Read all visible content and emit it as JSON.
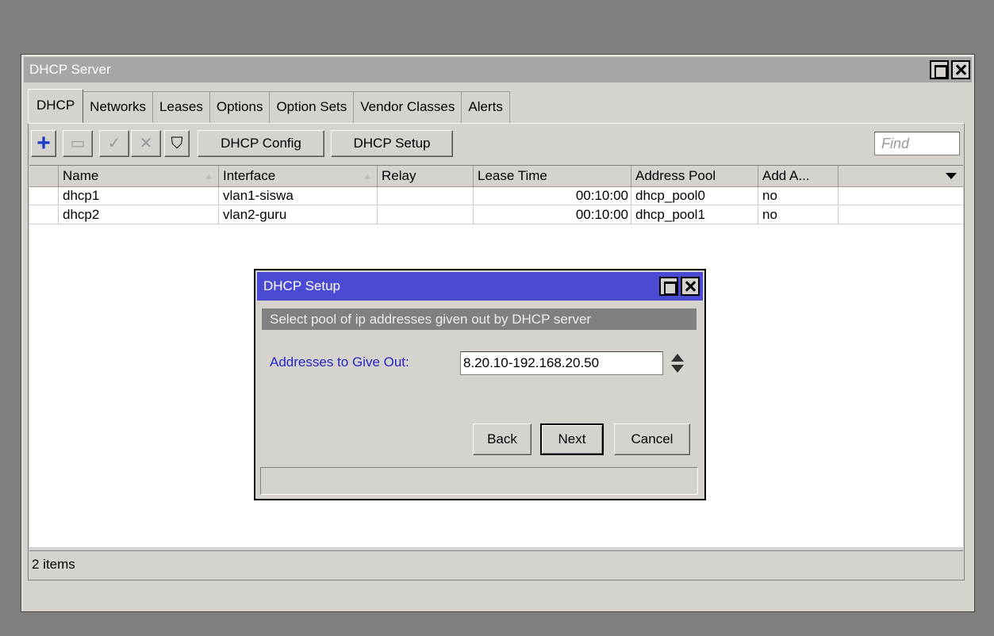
{
  "window": {
    "title": "DHCP Server",
    "tabs": [
      {
        "label": "DHCP",
        "active": true
      },
      {
        "label": "Networks"
      },
      {
        "label": "Leases"
      },
      {
        "label": "Options"
      },
      {
        "label": "Option Sets"
      },
      {
        "label": "Vendor Classes"
      },
      {
        "label": "Alerts"
      }
    ]
  },
  "toolbar": {
    "add_icon": "plus-icon",
    "remove_icon": "minus-icon",
    "enable_icon": "check-icon",
    "disable_icon": "cross-icon",
    "filter_icon": "filter-icon",
    "dhcp_config_label": "DHCP Config",
    "dhcp_setup_label": "DHCP Setup",
    "find_placeholder": "Find"
  },
  "table": {
    "columns": [
      "Name",
      "Interface",
      "Relay",
      "Lease Time",
      "Address Pool",
      "Add A..."
    ],
    "rows": [
      {
        "name": "dhcp1",
        "interface": "vlan1-siswa",
        "relay": "",
        "lease_time": "00:10:00",
        "address_pool": "dhcp_pool0",
        "add_arp": "no"
      },
      {
        "name": "dhcp2",
        "interface": "vlan2-guru",
        "relay": "",
        "lease_time": "00:10:00",
        "address_pool": "dhcp_pool1",
        "add_arp": "no"
      }
    ]
  },
  "status": {
    "items_count": "2 items"
  },
  "dialog": {
    "title": "DHCP Setup",
    "info": "Select pool of ip addresses given out by DHCP server",
    "field_label": "Addresses to Give Out:",
    "field_value": "8.20.10-192.168.20.50",
    "back_label": "Back",
    "next_label": "Next",
    "cancel_label": "Cancel"
  },
  "colors": {
    "dialog_title_bg": "#4a4ad4",
    "label_blue": "#2626c8",
    "window_bg": "#d6d3ce",
    "desktop_bg": "#808080"
  }
}
